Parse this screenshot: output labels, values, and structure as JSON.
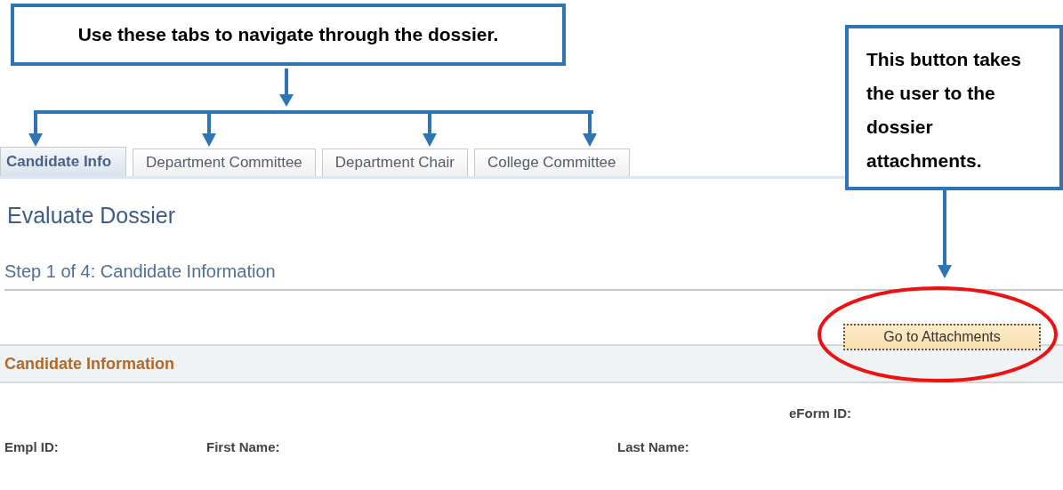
{
  "callouts": [
    {
      "text": "Use these tabs to navigate through the dossier."
    },
    {
      "text": "This button takes the user to the dossier attachments."
    }
  ],
  "tabs": [
    {
      "label": "Candidate Info",
      "selected": true
    },
    {
      "label": "Department Committee",
      "selected": false
    },
    {
      "label": "Department Chair",
      "selected": false
    },
    {
      "label": "College Committee",
      "selected": false
    }
  ],
  "page_title": "Evaluate Dossier",
  "step": "Step 1 of 4: Candidate Information",
  "attachments_button": "Go to Attachments",
  "section": {
    "title": "Candidate Information"
  },
  "fields": {
    "eform_id": "eForm ID:",
    "empl_id": "Empl ID:",
    "first_name": "First Name:",
    "last_name": "Last Name:"
  }
}
